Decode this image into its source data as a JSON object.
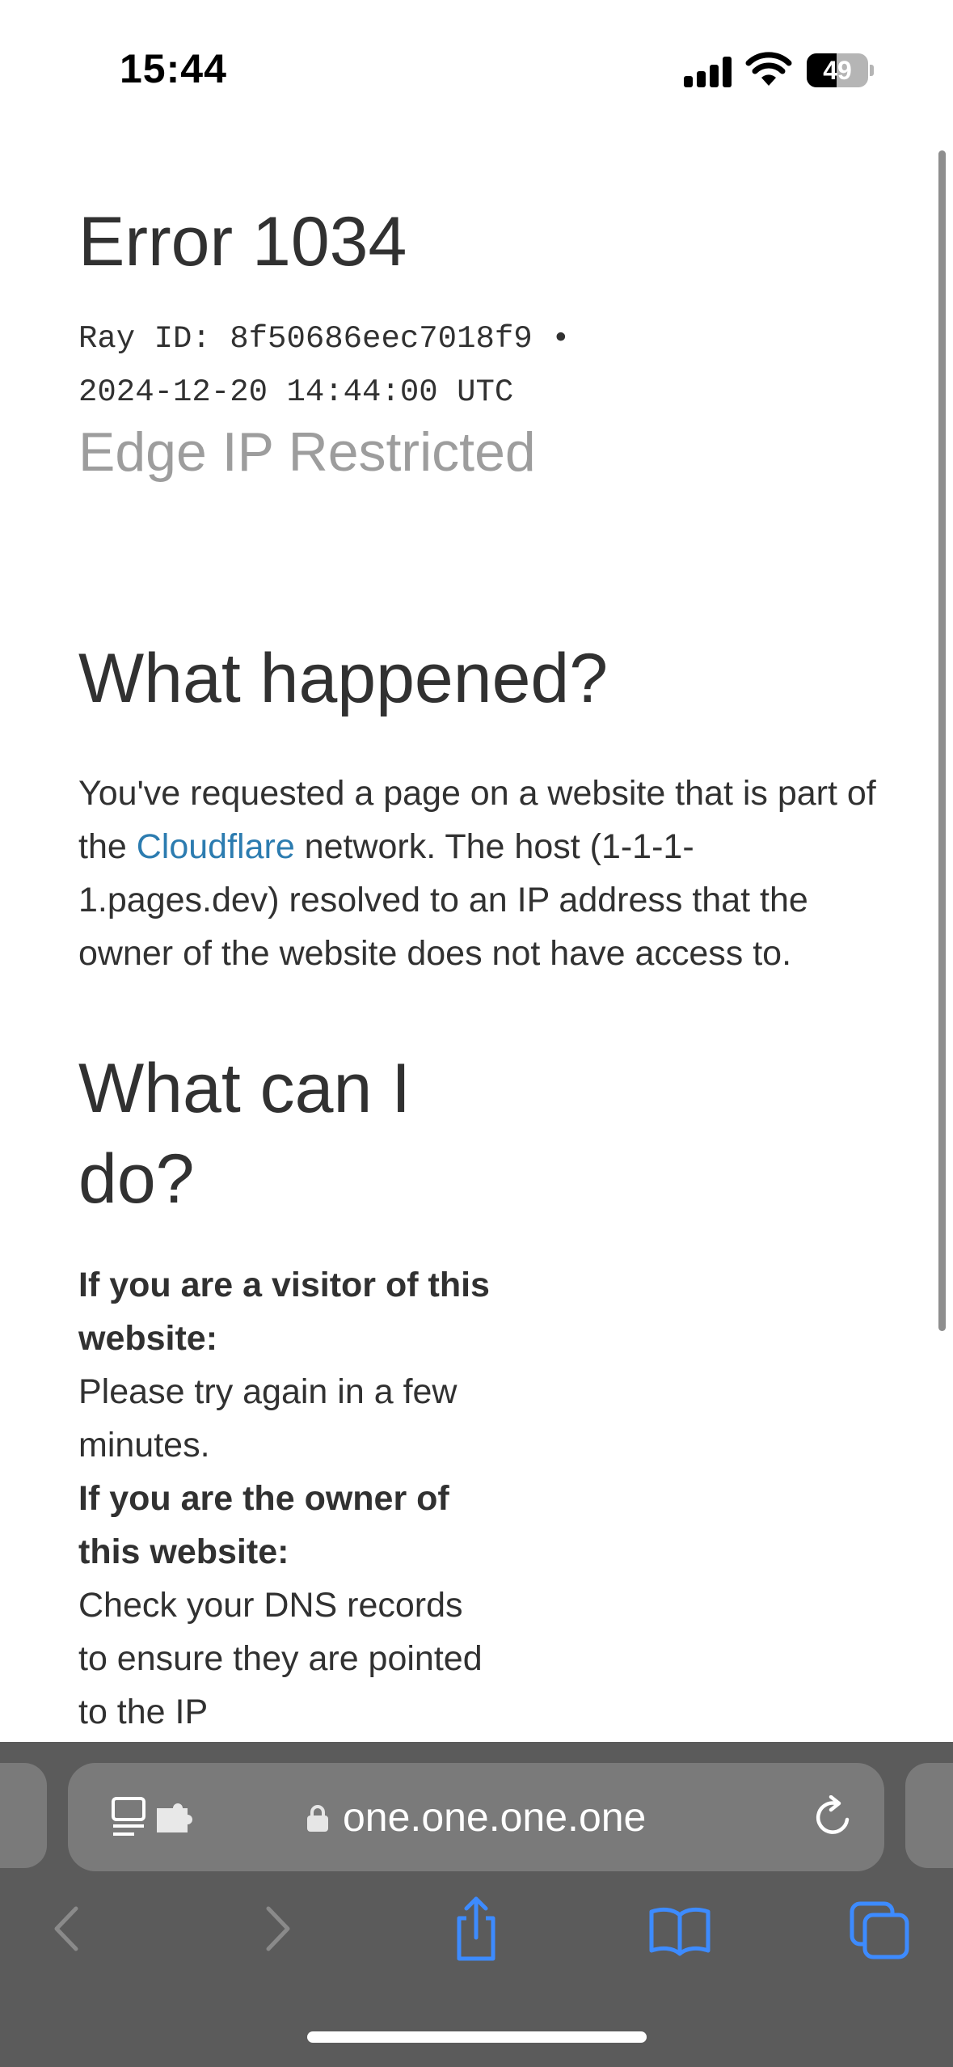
{
  "status_bar": {
    "time": "15:44",
    "battery_level": "49",
    "battery_fraction": 0.49
  },
  "page": {
    "error_title": "Error 1034",
    "ray_line1": "Ray ID: 8f50686eec7018f9 •",
    "ray_line2": "2024-12-20 14:44:00 UTC",
    "subtitle": "Edge IP Restricted",
    "what_happened_heading": "What happened?",
    "what_happened_before_link": "You've requested a page on a website that is part of the ",
    "cloudflare_link": "Cloudflare",
    "what_happened_after_link": " network. The host (1-1-1-1.pages.dev) resolved to an IP address that the owner of the website does not have access to.",
    "what_can_heading": "What can I do?",
    "visitor_heading": "If you are a visitor of this website:",
    "visitor_text": "Please try again in a few minutes.",
    "owner_heading": "If you are the owner of this website:",
    "owner_text": "Check your DNS records to ensure they are pointed to the IP"
  },
  "browser": {
    "url": "one.one.one.one"
  },
  "colors": {
    "link": "#2c7cb0",
    "toolbar_bg": "#5b5b5b",
    "url_pill": "#7a7a7a",
    "toolbar_icon_active": "#3d8bff",
    "toolbar_icon_disabled": "#8a8a8a"
  },
  "icons": [
    "signal-icon",
    "wifi-icon",
    "battery-icon",
    "reader-icon",
    "extension-icon",
    "lock-icon",
    "reload-icon",
    "back-icon",
    "forward-icon",
    "share-icon",
    "bookmarks-icon",
    "tabs-icon"
  ]
}
